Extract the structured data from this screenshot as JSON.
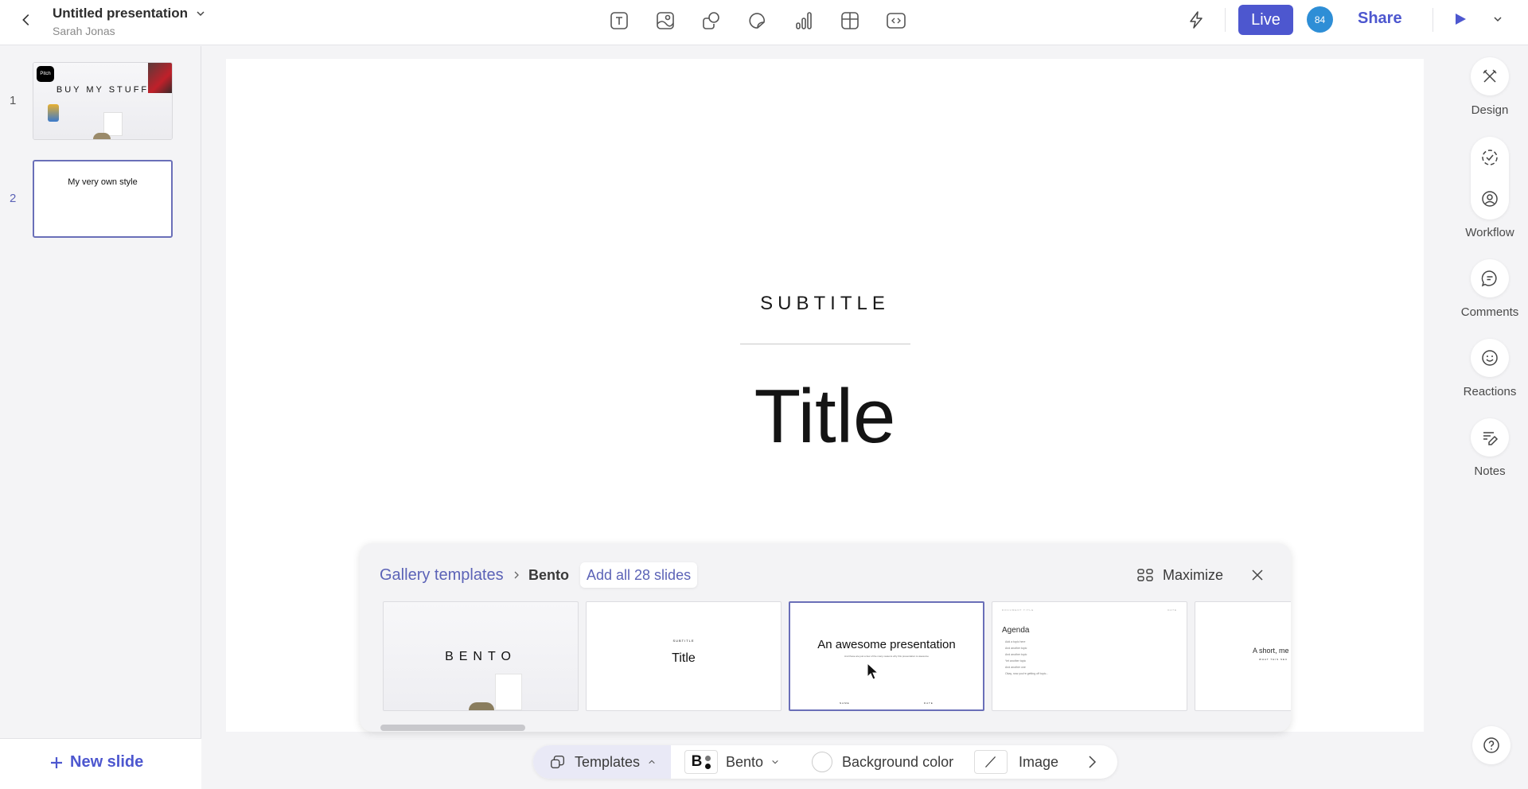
{
  "header": {
    "doc_title": "Untitled presentation",
    "owner": "Sarah Jonas",
    "insert_tools": [
      {
        "name": "text-tool",
        "icon": "text-box-icon"
      },
      {
        "name": "image-tool",
        "icon": "image-icon"
      },
      {
        "name": "shape-tool",
        "icon": "shapes-icon"
      },
      {
        "name": "sticker-tool",
        "icon": "sticker-icon"
      },
      {
        "name": "chart-tool",
        "icon": "bar-chart-icon"
      },
      {
        "name": "table-tool",
        "icon": "table-icon"
      },
      {
        "name": "embed-tool",
        "icon": "code-embed-icon"
      }
    ],
    "live_label": "Live",
    "avatar_initials": "84",
    "share_label": "Share",
    "accent_color": "#4d57cf",
    "avatar_color": "#2e8ed6"
  },
  "slides_panel": {
    "slides": [
      {
        "number": "1",
        "thumb_title": "BUY MY STUFF",
        "thumb_logo": "Pitch"
      },
      {
        "number": "2",
        "thumb_title": "My very own style",
        "selected": true
      }
    ],
    "new_slide_label": "New slide"
  },
  "canvas": {
    "subtitle": "SUBTITLE",
    "title": "Title"
  },
  "right_rail": {
    "design_label": "Design",
    "workflow_label": "Workflow",
    "comments_label": "Comments",
    "reactions_label": "Reactions",
    "notes_label": "Notes"
  },
  "gallery": {
    "breadcrumb_root": "Gallery templates",
    "breadcrumb_current": "Bento",
    "add_all_label": "Add all 28 slides",
    "maximize_label": "Maximize",
    "templates": [
      {
        "title": "BENTO"
      },
      {
        "subtitle": "SUBTITLE",
        "title": "Title"
      },
      {
        "title": "An awesome presentation",
        "body": "And these are just a few of the many reasons why this presentation is awesome",
        "footer_left": "NAME",
        "footer_right": "DATE"
      },
      {
        "header_left": "DOCUMENT TITLE",
        "header_right": "DATE",
        "title": "Agenda",
        "items": [
          "Add a topic here",
          "And another topic",
          "And another topic",
          "Yet another topic",
          "And another one",
          "Okay, now you're getting off topic..."
        ]
      },
      {
        "title": "A short, me",
        "subtitle": "WHAT THIS SEC"
      }
    ]
  },
  "bottom_toolbar": {
    "templates_label": "Templates",
    "theme_letter": "B",
    "theme_label": "Bento",
    "background_label": "Background color",
    "image_label": "Image"
  }
}
